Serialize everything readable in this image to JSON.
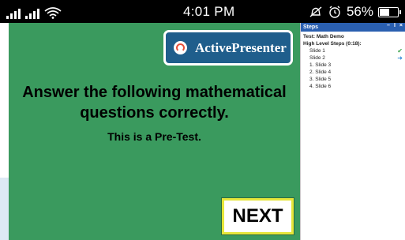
{
  "status_bar": {
    "time": "4:01 PM",
    "battery_percent": "56%",
    "battery_level": 0.56
  },
  "slide": {
    "logo_text": "ActivePresenter",
    "headline_line1": "Answer the following mathematical",
    "headline_line2": "questions correctly.",
    "subline": "This is a Pre-Test.",
    "next_label": "NEXT"
  },
  "steps_panel": {
    "title": "Steps",
    "controls": [
      "–",
      "I",
      "×"
    ],
    "test_name": "Test: Math Demo",
    "high_level": "High Level Steps (0:18):",
    "items": [
      {
        "label": "Slide 1",
        "status": "done"
      },
      {
        "label": "Slide 2",
        "status": "current"
      },
      {
        "label": "1. Slide 3",
        "status": ""
      },
      {
        "label": "2. Slide 4",
        "status": ""
      },
      {
        "label": "3. Slide 5",
        "status": ""
      },
      {
        "label": "4. Slide 6",
        "status": ""
      }
    ]
  }
}
